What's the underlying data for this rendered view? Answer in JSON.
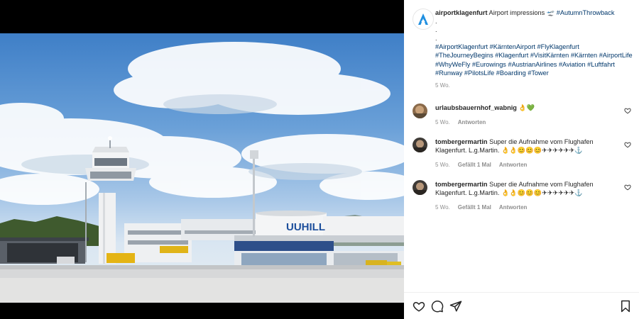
{
  "post": {
    "username": "airportklagenfurt",
    "caption_text": " Airport impressions ",
    "caption_emoji": "🛫",
    "caption_tag_first": "#AutumnThrowback",
    "dot_lines": [
      ".",
      ".",
      "."
    ],
    "hashtags": "#AirportKlagenfurt #KärntenAirport #FlyKlagenfurt #TheJourneyBegins #Klagenfurt #VisitKärnten #Kärnten #AirportLife #WhyWeFly #Eurowings #AustrianAirlines #Aviation #Luftfahrt #Runway #PilotsLife #Boarding #Tower",
    "time": "5 Wo."
  },
  "comments": [
    {
      "username": "urlaubsbauernhof_wabnig",
      "text": " 👌💚",
      "time": "5 Wo.",
      "likes": "",
      "reply": "Antworten"
    },
    {
      "username": "tombergermartin",
      "text": " Super die Aufnahme vom Flughafen Klagenfurt. L.g.Martin. 👌👌😊😊😊✈✈✈✈✈✈⚓",
      "time": "5 Wo.",
      "likes": "Gefällt 1 Mal",
      "reply": "Antworten"
    },
    {
      "username": "tombergermartin",
      "text": " Super die Aufnahme vom Flughafen Klagenfurt. L.g.Martin. 👌👌😊😊😊✈✈✈✈✈✈⚓",
      "time": "5 Wo.",
      "likes": "Gefällt 1 Mal",
      "reply": "Antworten"
    }
  ],
  "photo": {
    "terminal_sign": "UUHILL"
  },
  "icons": {
    "like": "heart-icon",
    "comment": "comment-icon",
    "share": "share-icon",
    "save": "bookmark-icon"
  },
  "colors": {
    "hashtag": "#00376b",
    "muted": "#8e8e8e",
    "logo_accent": "#1f8fe0"
  }
}
